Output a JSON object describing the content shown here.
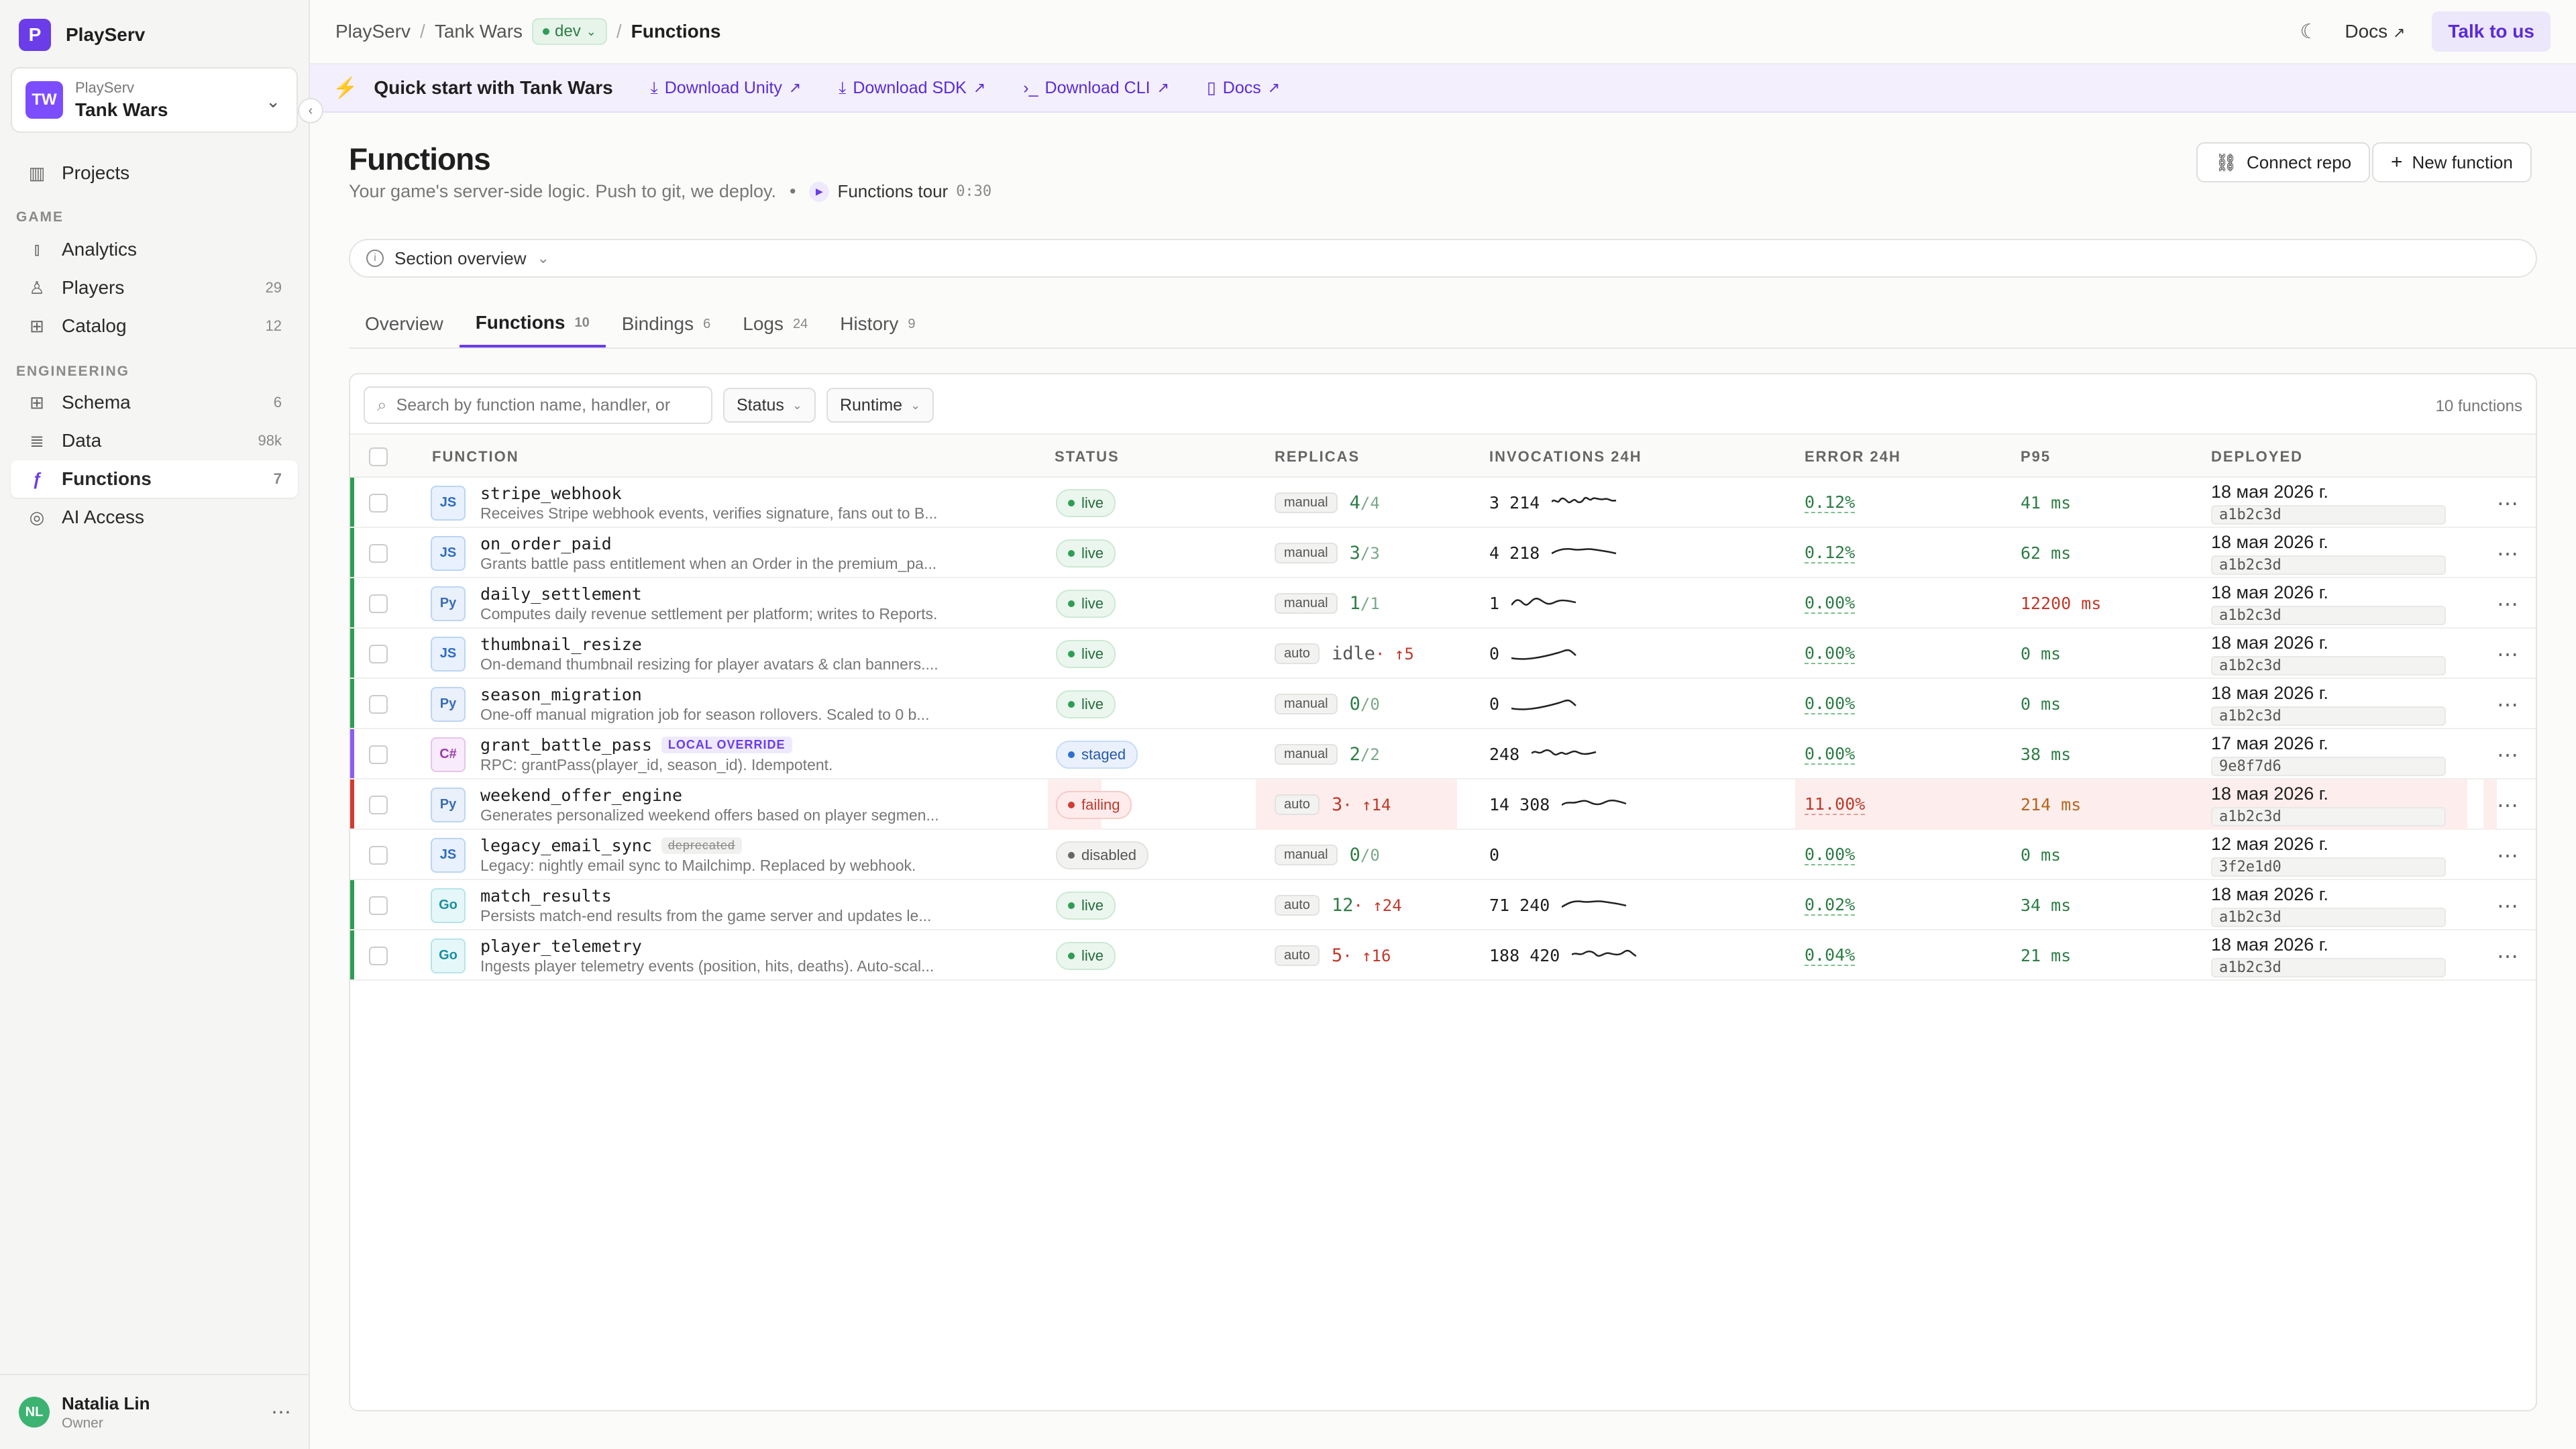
{
  "brand": {
    "logo": "P",
    "name": "PlayServ"
  },
  "project": {
    "avatar": "TW",
    "org": "PlayServ",
    "name": "Tank Wars"
  },
  "sidebar": {
    "projects": "Projects",
    "section_game": "GAME",
    "section_engineering": "ENGINEERING",
    "items": [
      {
        "label": "Analytics",
        "count": ""
      },
      {
        "label": "Players",
        "count": "29"
      },
      {
        "label": "Catalog",
        "count": "12"
      },
      {
        "label": "Schema",
        "count": "6"
      },
      {
        "label": "Data",
        "count": "98k"
      },
      {
        "label": "Functions",
        "count": "7"
      },
      {
        "label": "AI Access",
        "count": ""
      }
    ]
  },
  "user": {
    "initials": "NL",
    "name": "Natalia Lin",
    "role": "Owner"
  },
  "topbar": {
    "crumb1": "PlayServ",
    "crumb2": "Tank Wars",
    "env": "dev",
    "current": "Functions",
    "docs": "Docs",
    "talk": "Talk to us"
  },
  "quickstart": {
    "title": "Quick start with Tank Wars",
    "links": [
      "Download Unity",
      "Download SDK",
      "Download CLI",
      "Docs"
    ]
  },
  "page": {
    "title": "Functions",
    "subtitle": "Your game's server-side logic. Push to git, we deploy.",
    "tour": "Functions tour",
    "tour_time": "0:30",
    "connect_repo": "Connect repo",
    "new_function": "New function",
    "section_overview": "Section overview"
  },
  "tabs": [
    {
      "label": "Overview",
      "count": ""
    },
    {
      "label": "Functions",
      "count": "10"
    },
    {
      "label": "Bindings",
      "count": "6"
    },
    {
      "label": "Logs",
      "count": "24"
    },
    {
      "label": "History",
      "count": "9"
    }
  ],
  "toolbar": {
    "search_placeholder": "Search by function name, handler, or",
    "status": "Status",
    "runtime": "Runtime",
    "count": "10 functions"
  },
  "columns": {
    "function": "FUNCTION",
    "status": "STATUS",
    "replicas": "REPLICAS",
    "invocations": "INVOCATIONS 24H",
    "error": "ERROR 24H",
    "p95": "P95",
    "deployed": "DEPLOYED"
  },
  "rows": [
    {
      "runtime": "JS",
      "name": "stripe_webhook",
      "tag": "",
      "desc": "Receives Stripe webhook events, verifies signature, fans out to B...",
      "status": "live",
      "mode": "manual",
      "replicas_a": "4",
      "replicas_b": "/4",
      "invocations": "3 214",
      "error": "0.12%",
      "p95": "41 ms",
      "date": "18 мая 2026 г.",
      "hash": "a1b2c3d"
    },
    {
      "runtime": "JS",
      "name": "on_order_paid",
      "tag": "",
      "desc": "Grants battle pass entitlement when an Order in the premium_pa...",
      "status": "live",
      "mode": "manual",
      "replicas_a": "3",
      "replicas_b": "/3",
      "invocations": "4 218",
      "error": "0.12%",
      "p95": "62 ms",
      "date": "18 мая 2026 г.",
      "hash": "a1b2c3d"
    },
    {
      "runtime": "Py",
      "name": "daily_settlement",
      "tag": "",
      "desc": "Computes daily revenue settlement per platform; writes to Reports.",
      "status": "live",
      "mode": "manual",
      "replicas_a": "1",
      "replicas_b": "/1",
      "invocations": "1",
      "error": "0.00%",
      "p95": "12200 ms",
      "date": "18 мая 2026 г.",
      "hash": "a1b2c3d"
    },
    {
      "runtime": "JS",
      "name": "thumbnail_resize",
      "tag": "",
      "desc": "On-demand thumbnail resizing for player avatars & clan banners....",
      "status": "live",
      "mode": "auto",
      "replicas_a": "idle",
      "replicas_b": " · ↑5",
      "invocations": "0",
      "error": "0.00%",
      "p95": "0 ms",
      "date": "18 мая 2026 г.",
      "hash": "a1b2c3d"
    },
    {
      "runtime": "Py",
      "name": "season_migration",
      "tag": "",
      "desc": "One-off manual migration job for season rollovers. Scaled to 0 b...",
      "status": "live",
      "mode": "manual",
      "replicas_a": "0",
      "replicas_b": "/0",
      "invocations": "0",
      "error": "0.00%",
      "p95": "0 ms",
      "date": "18 мая 2026 г.",
      "hash": "a1b2c3d"
    },
    {
      "runtime": "C#",
      "name": "grant_battle_pass",
      "tag": "LOCAL OVERRIDE",
      "desc": "RPC: grantPass(player_id, season_id). Idempotent.",
      "status": "staged",
      "mode": "manual",
      "replicas_a": "2",
      "replicas_b": "/2",
      "invocations": "248",
      "error": "0.00%",
      "p95": "38 ms",
      "date": "17 мая 2026 г.",
      "hash": "9e8f7d6"
    },
    {
      "runtime": "Py",
      "name": "weekend_offer_engine",
      "tag": "",
      "desc": "Generates personalized weekend offers based on player segmen...",
      "status": "failing",
      "mode": "auto",
      "replicas_a": "3",
      "replicas_b": " · ↑14",
      "invocations": "14 308",
      "error": "11.00%",
      "p95": "214 ms",
      "date": "18 мая 2026 г.",
      "hash": "a1b2c3d"
    },
    {
      "runtime": "JS",
      "name": "legacy_email_sync",
      "tag": "deprecated",
      "desc": "Legacy: nightly email sync to Mailchimp. Replaced by webhook.",
      "status": "disabled",
      "mode": "manual",
      "replicas_a": "0",
      "replicas_b": "/0",
      "invocations": "0",
      "error": "0.00%",
      "p95": "0 ms",
      "date": "12 мая 2026 г.",
      "hash": "3f2e1d0"
    },
    {
      "runtime": "Go",
      "name": "match_results",
      "tag": "",
      "desc": "Persists match-end results from the game server and updates le...",
      "status": "live",
      "mode": "auto",
      "replicas_a": "12",
      "replicas_b": " · ↑24",
      "invocations": "71 240",
      "error": "0.02%",
      "p95": "34 ms",
      "date": "18 мая 2026 г.",
      "hash": "a1b2c3d"
    },
    {
      "runtime": "Go",
      "name": "player_telemetry",
      "tag": "",
      "desc": "Ingests player telemetry events (position, hits, deaths). Auto-scal...",
      "status": "live",
      "mode": "auto",
      "replicas_a": "5",
      "replicas_b": " · ↑16",
      "invocations": "188 420",
      "error": "0.04%",
      "p95": "21 ms",
      "date": "18 мая 2026 г.",
      "hash": "a1b2c3d"
    }
  ],
  "colors": {
    "accent": "#6a3de8",
    "live": "#2e9e55",
    "failing": "#c0392b",
    "staged": "#2559a8"
  }
}
